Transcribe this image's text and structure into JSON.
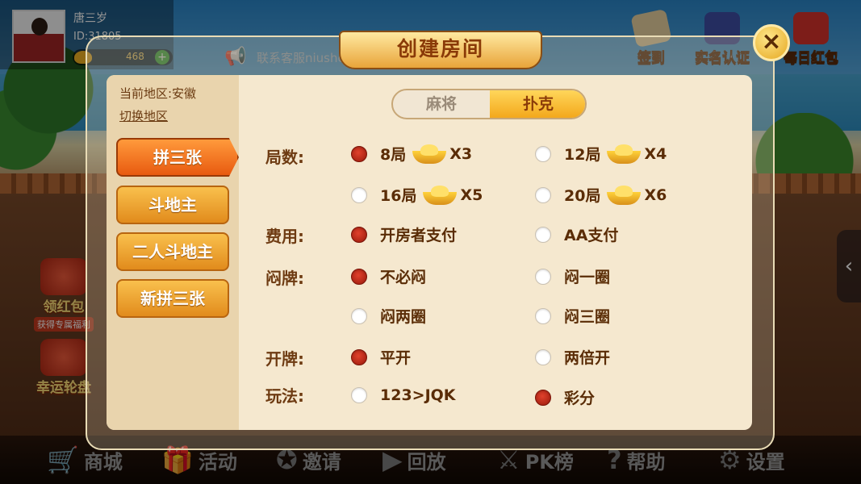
{
  "profile": {
    "name": "唐三岁",
    "id": "ID:31805",
    "coins": "468",
    "add": "+"
  },
  "notice": {
    "text": "联系客服niushc                                  ，不限次"
  },
  "top_buttons": {
    "signin": "签到",
    "realname": "实名认证",
    "redpacket": "每日红包"
  },
  "side": {
    "hongbao": "领红包",
    "hongbao_sub": "获得专属福利",
    "lucky": "幸运轮盘"
  },
  "bottom_bar": {
    "shop": "商城",
    "activity": "活动",
    "invite": "邀请",
    "replay": "回放",
    "pk": "PK榜",
    "help": "帮助",
    "settings": "设置"
  },
  "modal": {
    "title": "创建房间",
    "close": "×",
    "region": "当前地区:安徽",
    "switch_region": "切换地区",
    "games": [
      "拼三张",
      "斗地主",
      "二人斗地主",
      "新拼三张"
    ],
    "active_game": "拼三张",
    "tabs": {
      "mahjong": "麻将",
      "poker": "扑克",
      "active": "扑克"
    },
    "rows": {
      "rounds": {
        "label": "局数:",
        "options": [
          {
            "text": "8局",
            "mult": "X3",
            "selected": true
          },
          {
            "text": "12局",
            "mult": "X4",
            "selected": false
          },
          {
            "text": "16局",
            "mult": "X5",
            "selected": false
          },
          {
            "text": "20局",
            "mult": "X6",
            "selected": false
          }
        ]
      },
      "cost": {
        "label": "费用:",
        "options": [
          {
            "text": "开房者支付",
            "selected": true
          },
          {
            "text": "AA支付",
            "selected": false
          }
        ]
      },
      "menpai": {
        "label": "闷牌:",
        "options": [
          {
            "text": "不必闷",
            "selected": true
          },
          {
            "text": "闷一圈",
            "selected": false
          },
          {
            "text": "闷两圈",
            "selected": false
          },
          {
            "text": "闷三圈",
            "selected": false
          }
        ]
      },
      "kaipai": {
        "label": "开牌:",
        "options": [
          {
            "text": "平开",
            "selected": true
          },
          {
            "text": "两倍开",
            "selected": false
          }
        ]
      },
      "wanfa": {
        "label": "玩法:",
        "options": [
          {
            "text": "123>JQK",
            "selected": false
          },
          {
            "text": "彩分",
            "selected": true
          }
        ]
      }
    }
  },
  "colors": {
    "accent": "#e85a10",
    "label": "#6e3b12",
    "radio_on": "#c0271a"
  }
}
